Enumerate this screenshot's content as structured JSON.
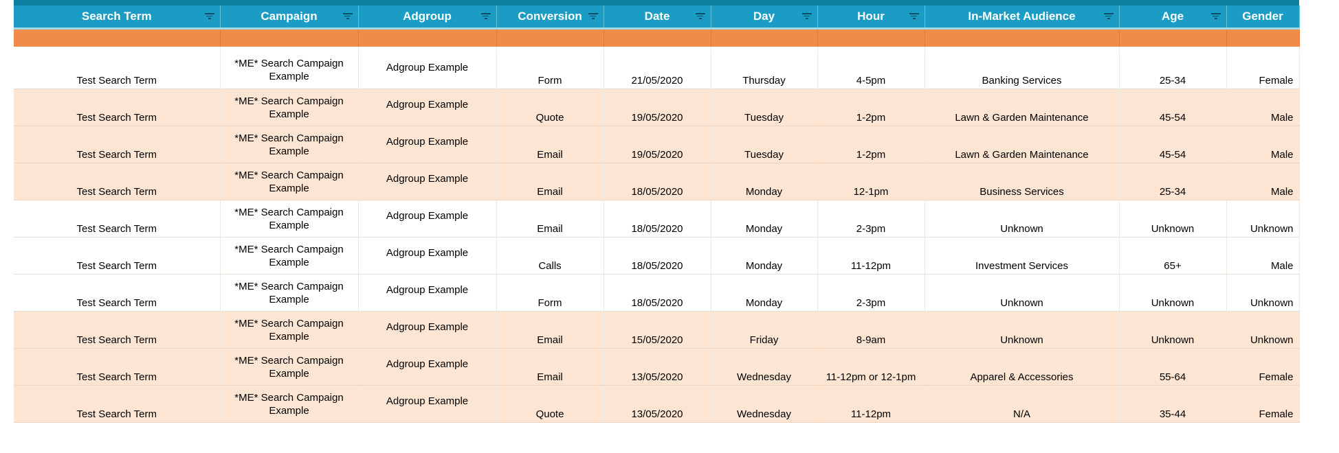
{
  "colors": {
    "header_bg": "#1a9cc4",
    "header_top": "#0e7fa1",
    "band": "#f08c4a",
    "row_peach": "#fce5d2",
    "row_white": "#ffffff"
  },
  "columns": [
    {
      "label": "Search Term",
      "filter_icon": "filter-icon"
    },
    {
      "label": "Campaign",
      "filter_icon": "filter-icon"
    },
    {
      "label": "Adgroup",
      "filter_icon": "filter-icon"
    },
    {
      "label": "Conversion",
      "filter_icon": "filter-icon"
    },
    {
      "label": "Date",
      "filter_icon": "filter-icon"
    },
    {
      "label": "Day",
      "filter_icon": "filter-icon"
    },
    {
      "label": "Hour",
      "filter_icon": "filter-icon"
    },
    {
      "label": "In-Market Audience",
      "filter_icon": "filter-icon"
    },
    {
      "label": "Age",
      "filter_icon": "filter-icon"
    },
    {
      "label": "Gender",
      "filter_icon": null
    }
  ],
  "rows": [
    {
      "shade": "white",
      "search_term": "Test Search Term",
      "campaign_line1": "*ME* Search Campaign",
      "campaign_line2": "Example",
      "adgroup": "Adgroup Example",
      "conversion": "Form",
      "date": "21/05/2020",
      "day": "Thursday",
      "hour": "4-5pm",
      "audience": "Banking Services",
      "age": "25-34",
      "gender": "Female"
    },
    {
      "shade": "peach",
      "search_term": "Test Search Term",
      "campaign_line1": "*ME* Search Campaign",
      "campaign_line2": "Example",
      "adgroup": "Adgroup Example",
      "conversion": "Quote",
      "date": "19/05/2020",
      "day": "Tuesday",
      "hour": "1-2pm",
      "audience": "Lawn & Garden Maintenance",
      "age": "45-54",
      "gender": "Male"
    },
    {
      "shade": "peach",
      "search_term": "Test Search Term",
      "campaign_line1": "*ME* Search Campaign",
      "campaign_line2": "Example",
      "adgroup": "Adgroup Example",
      "conversion": "Email",
      "date": "19/05/2020",
      "day": "Tuesday",
      "hour": "1-2pm",
      "audience": "Lawn & Garden Maintenance",
      "age": "45-54",
      "gender": "Male"
    },
    {
      "shade": "peach",
      "search_term": "Test Search Term",
      "campaign_line1": "*ME* Search Campaign",
      "campaign_line2": "Example",
      "adgroup": "Adgroup Example",
      "conversion": "Email",
      "date": "18/05/2020",
      "day": "Monday",
      "hour": "12-1pm",
      "audience": "Business Services",
      "age": "25-34",
      "gender": "Male"
    },
    {
      "shade": "white",
      "search_term": "Test Search Term",
      "campaign_line1": "*ME* Search Campaign",
      "campaign_line2": "Example",
      "adgroup": "Adgroup Example",
      "conversion": "Email",
      "date": "18/05/2020",
      "day": "Monday",
      "hour": "2-3pm",
      "audience": "Unknown",
      "age": "Unknown",
      "gender": "Unknown"
    },
    {
      "shade": "white",
      "search_term": "Test Search Term",
      "campaign_line1": "*ME* Search Campaign",
      "campaign_line2": "Example",
      "adgroup": "Adgroup Example",
      "conversion": "Calls",
      "date": "18/05/2020",
      "day": "Monday",
      "hour": "11-12pm",
      "audience": "Investment Services",
      "age": "65+",
      "gender": "Male"
    },
    {
      "shade": "white",
      "search_term": "Test Search Term",
      "campaign_line1": "*ME* Search Campaign",
      "campaign_line2": "Example",
      "adgroup": "Adgroup Example",
      "conversion": "Form",
      "date": "18/05/2020",
      "day": "Monday",
      "hour": "2-3pm",
      "audience": "Unknown",
      "age": "Unknown",
      "gender": "Unknown"
    },
    {
      "shade": "peach",
      "search_term": "Test Search Term",
      "campaign_line1": "*ME* Search Campaign",
      "campaign_line2": "Example",
      "adgroup": "Adgroup Example",
      "conversion": "Email",
      "date": "15/05/2020",
      "day": "Friday",
      "hour": "8-9am",
      "audience": "Unknown",
      "age": "Unknown",
      "gender": "Unknown"
    },
    {
      "shade": "peach",
      "search_term": "Test Search Term",
      "campaign_line1": "*ME* Search Campaign",
      "campaign_line2": "Example",
      "adgroup": "Adgroup Example",
      "conversion": "Email",
      "date": "13/05/2020",
      "day": "Wednesday",
      "hour": "11-12pm or 12-1pm",
      "audience": "Apparel & Accessories",
      "age": "55-64",
      "gender": "Female"
    },
    {
      "shade": "peach",
      "search_term": "Test Search Term",
      "campaign_line1": "*ME* Search Campaign",
      "campaign_line2": "Example",
      "adgroup": "Adgroup Example",
      "conversion": "Quote",
      "date": "13/05/2020",
      "day": "Wednesday",
      "hour": "11-12pm",
      "audience": "N/A",
      "age": "35-44",
      "gender": "Female"
    }
  ]
}
